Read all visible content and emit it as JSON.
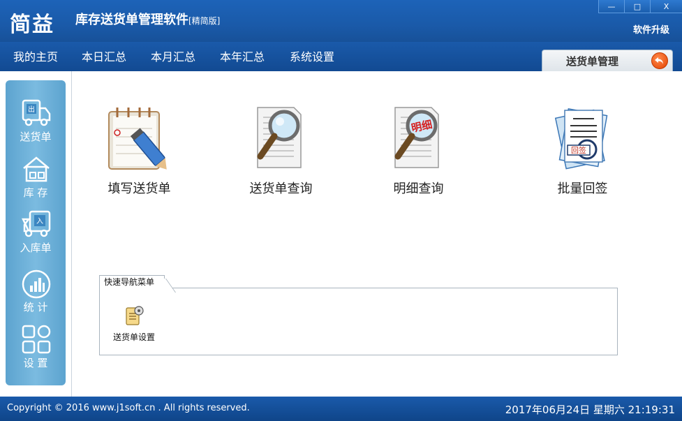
{
  "window": {
    "logo_text": "简益",
    "title": "库存送货单管理软件",
    "edition": "[精简版]",
    "controls": {
      "minimize": "—",
      "maximize": "□",
      "close": "X"
    },
    "upgrade_label": "软件升级"
  },
  "menu": {
    "items": [
      {
        "label": "我的主页"
      },
      {
        "label": "本日汇总"
      },
      {
        "label": "本月汇总"
      },
      {
        "label": "本年汇总"
      },
      {
        "label": "系统设置"
      }
    ],
    "active_tab": {
      "label": "送货单管理",
      "back_icon": "back-arrow-icon"
    }
  },
  "sidebar": {
    "items": [
      {
        "label": "送货单",
        "icon": "truck-out-icon",
        "icon_text": "出"
      },
      {
        "label": "库 存",
        "icon": "warehouse-icon"
      },
      {
        "label": "入库单",
        "icon": "truck-in-icon",
        "icon_text": "入"
      },
      {
        "label": "统 计",
        "icon": "bar-chart-icon"
      },
      {
        "label": "设 置",
        "icon": "grid-settings-icon"
      }
    ]
  },
  "features": [
    {
      "label": "填写送货单",
      "icon": "notebook-pencil-icon"
    },
    {
      "label": "送货单查询",
      "icon": "document-magnifier-icon"
    },
    {
      "label": "明细查询",
      "icon": "detail-magnifier-icon",
      "icon_text": "明细"
    },
    {
      "label": "批量回签",
      "icon": "stamp-document-icon",
      "icon_text": "回签"
    }
  ],
  "quick_nav": {
    "title": "快速导航菜单",
    "items": [
      {
        "label": "送货单设置",
        "icon": "document-gear-icon"
      }
    ]
  },
  "footer": {
    "copyright": "Copyright © 2016 www.j1soft.cn . All rights reserved.",
    "datetime": "2017年06月24日  星期六 21:19:31"
  },
  "colors": {
    "title_bar": "#1a5aa9",
    "sidebar": "#6cb0d8",
    "footer": "#124a92",
    "accent_orange": "#e34200"
  }
}
